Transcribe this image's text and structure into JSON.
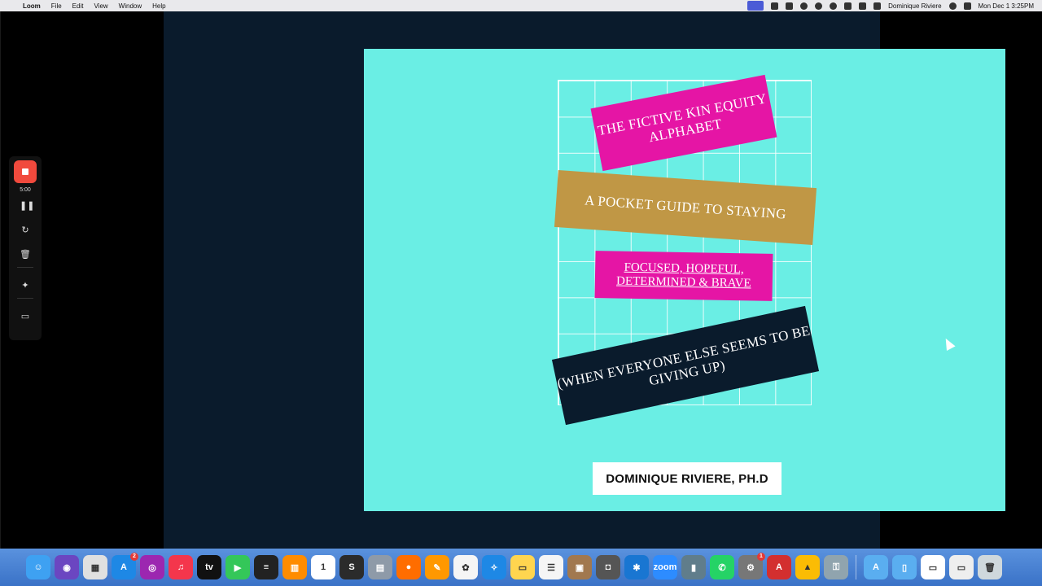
{
  "menubar": {
    "app_name": "Loom",
    "menus": [
      "File",
      "Edit",
      "View",
      "Window",
      "Help"
    ],
    "user": "Dominique Riviere",
    "clock": "Mon Dec 1  3:25PM"
  },
  "slide": {
    "band1": "THE FICTIVE KIN EQUITY ALPHABET",
    "band2": "A POCKET GUIDE TO STAYING",
    "band3": "FOCUSED, HOPEFUL, DETERMINED & BRAVE",
    "band4": "(WHEN EVERYONE ELSE SEEMS TO BE GIVING UP)",
    "author": "DOMINIQUE RIVIERE, PH.D"
  },
  "loom": {
    "time": "5:00"
  },
  "dock": {
    "apps": [
      {
        "name": "finder",
        "color": "#3ea1f2",
        "glyph": "☺"
      },
      {
        "name": "siri",
        "color": "#6b46c1",
        "glyph": "◉"
      },
      {
        "name": "launchpad",
        "color": "#e0e0e0",
        "glyph": "▦"
      },
      {
        "name": "app-store",
        "color": "#1e88e5",
        "glyph": "A",
        "badge": "2"
      },
      {
        "name": "podcasts",
        "color": "#9c27b0",
        "glyph": "◎"
      },
      {
        "name": "music",
        "color": "#f4364c",
        "glyph": "♫"
      },
      {
        "name": "tv",
        "color": "#111111",
        "glyph": "tv"
      },
      {
        "name": "facetime",
        "color": "#34c759",
        "glyph": "▶"
      },
      {
        "name": "voice-memos",
        "color": "#222222",
        "glyph": "≡"
      },
      {
        "name": "books",
        "color": "#ff8c00",
        "glyph": "▥"
      },
      {
        "name": "calendar",
        "color": "#ffffff",
        "glyph": "1"
      },
      {
        "name": "scrivener",
        "color": "#2b2b2b",
        "glyph": "S"
      },
      {
        "name": "preview",
        "color": "#8e9aa8",
        "glyph": "▤"
      },
      {
        "name": "firefox",
        "color": "#ff6d00",
        "glyph": "●"
      },
      {
        "name": "pages",
        "color": "#ff9800",
        "glyph": "✎"
      },
      {
        "name": "photos",
        "color": "#f5f5f5",
        "glyph": "✿"
      },
      {
        "name": "safari",
        "color": "#1e88e5",
        "glyph": "✧"
      },
      {
        "name": "notes",
        "color": "#ffd54f",
        "glyph": "▭"
      },
      {
        "name": "reminders",
        "color": "#f5f5f5",
        "glyph": "☰"
      },
      {
        "name": "archive",
        "color": "#a1784f",
        "glyph": "▣"
      },
      {
        "name": "screenshot",
        "color": "#555555",
        "glyph": "◘"
      },
      {
        "name": "settings-blue",
        "color": "#1976d2",
        "glyph": "✱"
      },
      {
        "name": "zoom",
        "color": "#2d8cff",
        "glyph": "zoom"
      },
      {
        "name": "remote",
        "color": "#607d8b",
        "glyph": "▮"
      },
      {
        "name": "whatsapp",
        "color": "#25d366",
        "glyph": "✆"
      },
      {
        "name": "system-preferences",
        "color": "#777777",
        "glyph": "⚙",
        "badge": "1"
      },
      {
        "name": "acrobat",
        "color": "#d32f2f",
        "glyph": "A"
      },
      {
        "name": "google-drive",
        "color": "#fbbc04",
        "glyph": "▲"
      },
      {
        "name": "keychain",
        "color": "#90a4ae",
        "glyph": "⚿"
      }
    ],
    "trailing": [
      {
        "name": "applications-folder",
        "color": "#5aaef0",
        "glyph": "A"
      },
      {
        "name": "documents-folder",
        "color": "#5aaef0",
        "glyph": "▯"
      },
      {
        "name": "screenshot-thumb",
        "color": "#ffffff",
        "glyph": "▭"
      },
      {
        "name": "screenshot-thumb-2",
        "color": "#eeeeee",
        "glyph": "▭"
      },
      {
        "name": "trash",
        "color": "#cfd8dc",
        "glyph": "🗑"
      }
    ]
  }
}
